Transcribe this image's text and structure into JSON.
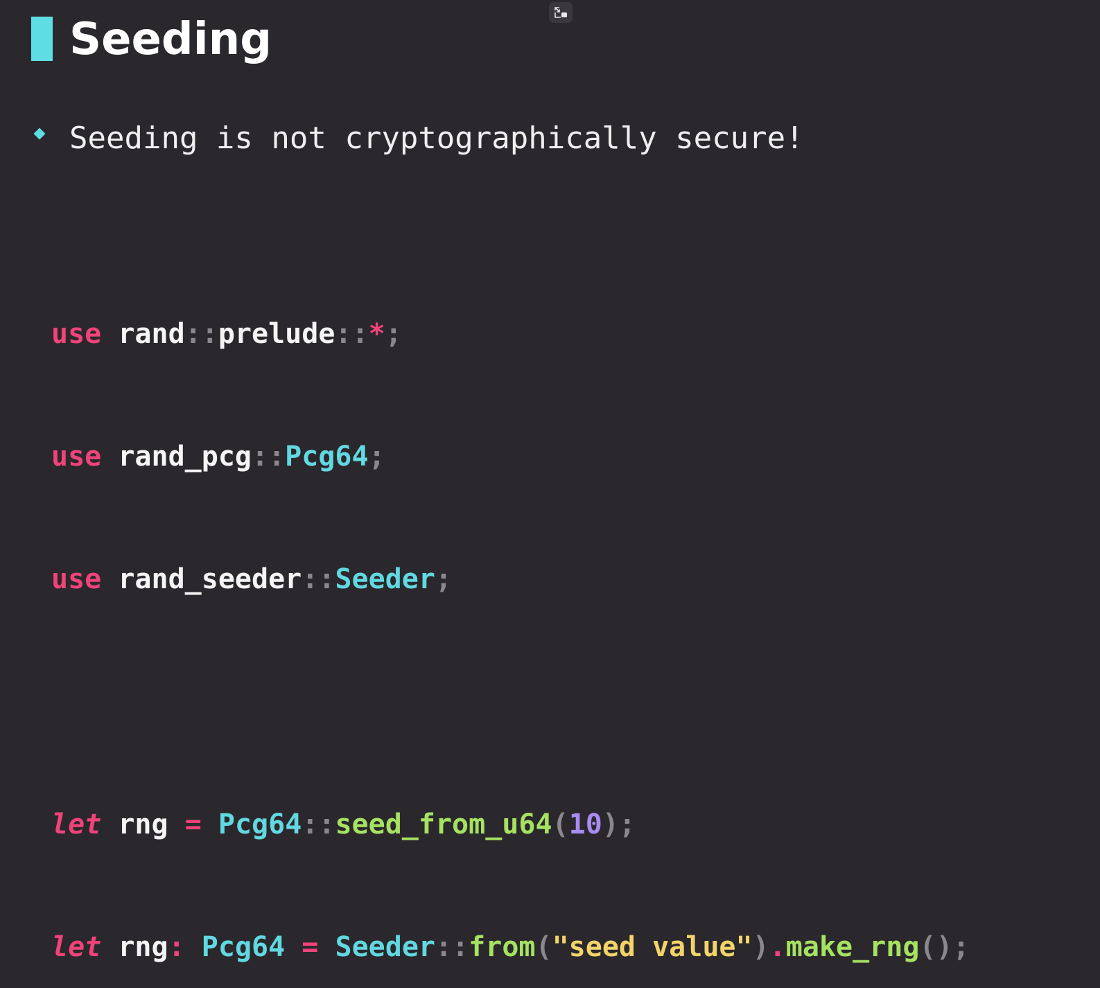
{
  "slide": {
    "title": "Seeding",
    "bullet": "Seeding is not cryptographically secure!"
  },
  "colors": {
    "background": "#2a282c",
    "accent": "#5fdde5",
    "keyword": "#f0437a",
    "type": "#62d8e1",
    "function": "#a6e262",
    "number": "#a88cf3",
    "string": "#f2d46a",
    "punctuation": "#8a878d"
  },
  "code": {
    "line1": {
      "kw": "use",
      "sp1": " ",
      "crate": "rand",
      "sep1": "::",
      "mod": "prelude",
      "sep2": "::",
      "glob": "*",
      "semi": ";"
    },
    "line2": {
      "kw": "use",
      "sp1": " ",
      "crate": "rand_pcg",
      "sep1": "::",
      "type": "Pcg64",
      "semi": ";"
    },
    "line3": {
      "kw": "use",
      "sp1": " ",
      "crate": "rand_seeder",
      "sep1": "::",
      "type": "Seeder",
      "semi": ";"
    },
    "line4": {
      "kw": "let",
      "sp1": " ",
      "var": "rng",
      "sp2": " ",
      "eq": "=",
      "sp3": " ",
      "type": "Pcg64",
      "sep1": "::",
      "fn": "seed_from_u64",
      "lparen": "(",
      "num": "10",
      "rparen": ")",
      "semi": ";"
    },
    "line5": {
      "kw": "let",
      "sp1": " ",
      "var": "rng",
      "colon": ":",
      "sp2": " ",
      "type": "Pcg64",
      "sp3": " ",
      "eq": "=",
      "sp4": " ",
      "type2": "Seeder",
      "sep1": "::",
      "fn": "from",
      "lparen": "(",
      "q1": "\"",
      "str": "seed value",
      "q2": "\"",
      "rparen": ")",
      "dot": ".",
      "fn2": "make_rng",
      "call": "()",
      "semi": ";"
    }
  },
  "icons": {
    "pip": "picture-in-picture-exit-icon"
  }
}
